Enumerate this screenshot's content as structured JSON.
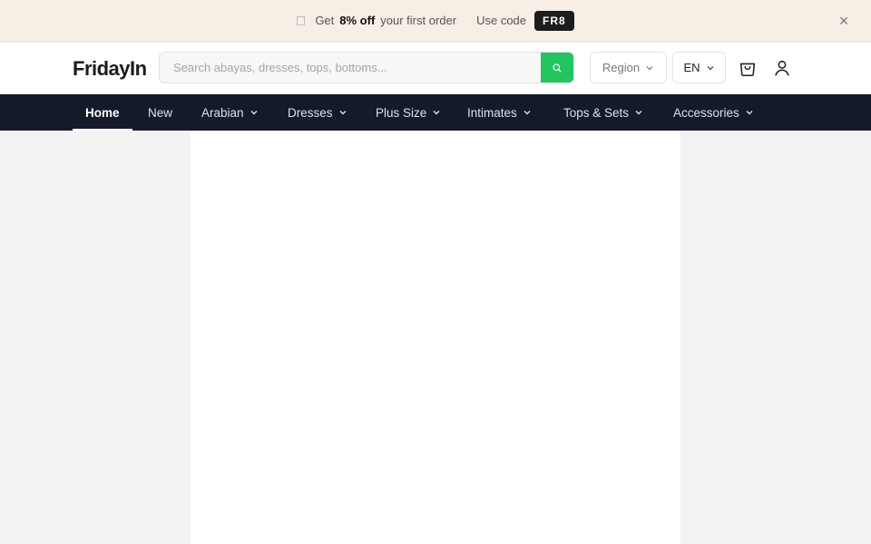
{
  "promo": {
    "prefix": "Get",
    "discount": "8% off",
    "suffix": "your first order",
    "use_code_label": "Use code",
    "code": "FR8",
    "close_glyph": "×"
  },
  "header": {
    "logo": "FridayIn",
    "search": {
      "placeholder": "Search abayas, dresses, tops, bottoms..."
    },
    "region_label": "Region",
    "language": "EN"
  },
  "nav": {
    "items": [
      {
        "label": "Home"
      },
      {
        "label": "New"
      },
      {
        "label": "Arabian"
      },
      {
        "label": "Dresses"
      },
      {
        "label": "Plus Size"
      },
      {
        "label": "Intimates"
      },
      {
        "label": "Tops & Sets"
      },
      {
        "label": "Accessories"
      }
    ]
  },
  "icons": {
    "tag": "tag-icon",
    "search": "search-icon",
    "chevron": "chevron-down-icon",
    "cart": "shopping-bag-icon",
    "user": "user-icon",
    "close": "close-icon"
  },
  "colors": {
    "promo_bg": "#f7efe6",
    "accent_green": "#22c55e",
    "nav_bg": "#141a29",
    "code_bg": "#1c1c1c"
  }
}
